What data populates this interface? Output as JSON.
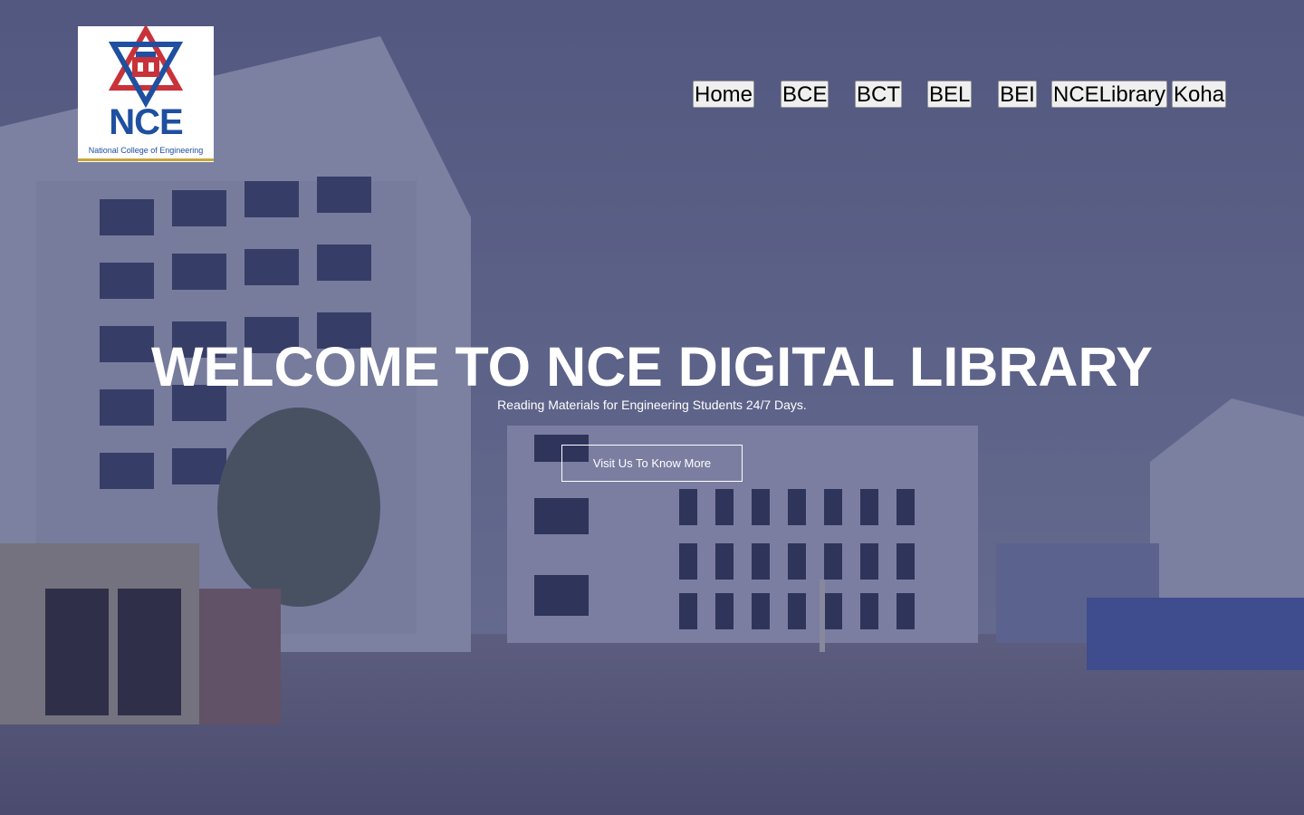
{
  "logo": {
    "name": "NCE",
    "subtitle": "National College of Engineering"
  },
  "nav": {
    "items": [
      {
        "label": "Home"
      },
      {
        "label": "BCE"
      },
      {
        "label": "BCT"
      },
      {
        "label": "BEL"
      },
      {
        "label": "BEI"
      },
      {
        "label": "NCELibrary"
      },
      {
        "label": "Koha"
      }
    ]
  },
  "hero": {
    "title": "WELCOME TO NCE DIGITAL LIBRARY",
    "subtitle": "Reading Materials for Engineering Students 24/7 Days.",
    "cta_label": "Visit Us To Know More"
  },
  "colors": {
    "overlay": "#1e2050",
    "brand_blue": "#1f4fa0",
    "brand_red": "#c8323a",
    "text_light": "#ffffff"
  }
}
